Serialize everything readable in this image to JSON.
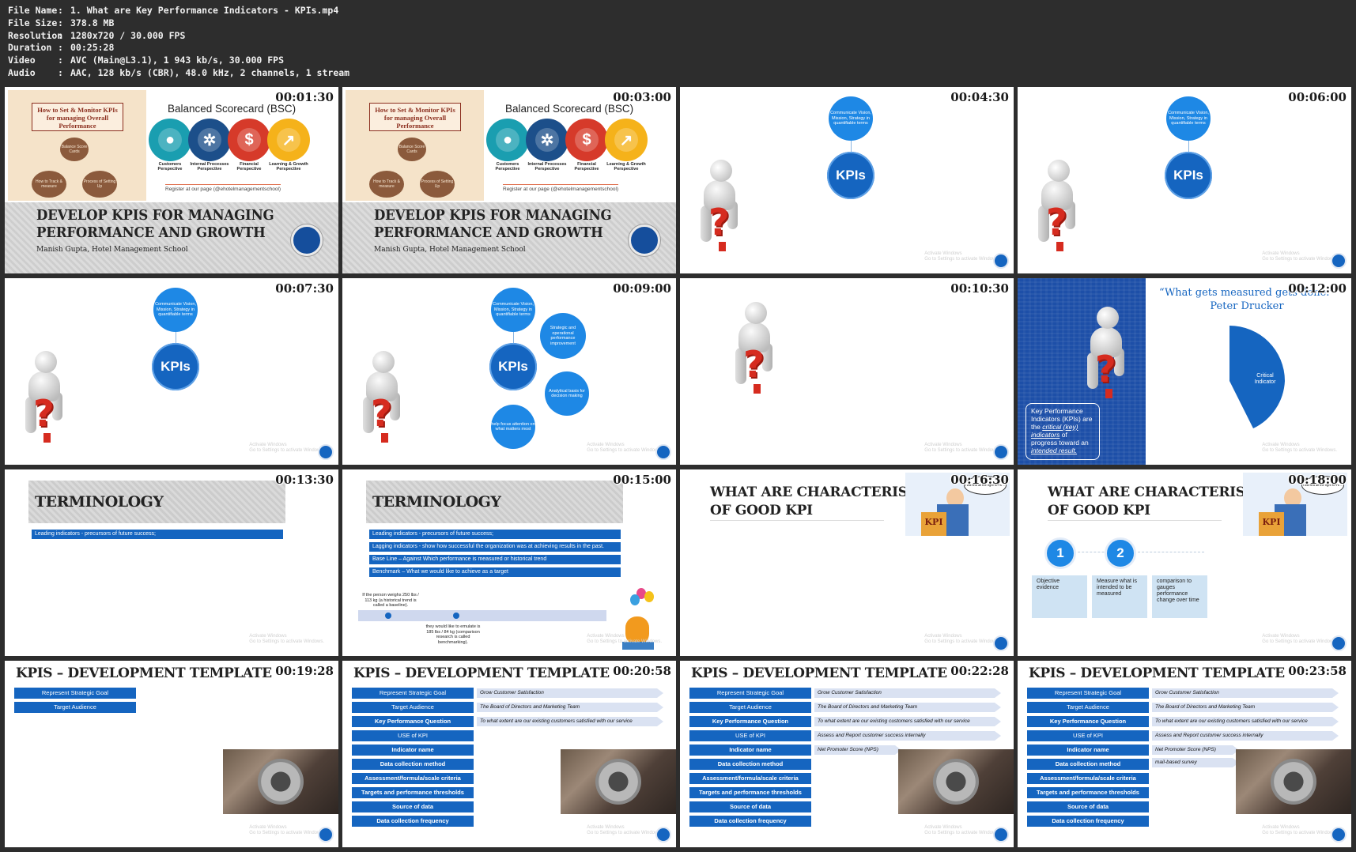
{
  "info": {
    "rows": [
      {
        "key": "File Name",
        "value": "1. What are Key Performance Indicators - KPIs.mp4"
      },
      {
        "key": "File Size",
        "value": "378.8 MB"
      },
      {
        "key": "Resolution",
        "value": "1280x720 / 30.000 FPS"
      },
      {
        "key": "Duration",
        "value": "00:25:28"
      },
      {
        "key": "Video",
        "value": "AVC (Main@L3.1), 1 943 kb/s, 30.000 FPS"
      },
      {
        "key": "Audio",
        "value": "AAC, 128 kb/s (CBR), 48.0 kHz, 2 channels, 1 stream"
      }
    ]
  },
  "timestamps": [
    "00:01:30",
    "00:03:00",
    "00:04:30",
    "00:06:00",
    "00:07:30",
    "00:09:00",
    "00:10:30",
    "00:12:00",
    "00:13:30",
    "00:15:00",
    "00:16:30",
    "00:18:00",
    "00:19:28",
    "00:20:58",
    "00:22:28",
    "00:23:58"
  ],
  "watermark": {
    "line1": "Activate Windows",
    "line2": "Go to Settings to activate Windows."
  },
  "slide_title": {
    "box": "How to Set & Monitor KPIs for managing Overall Performance",
    "bsc_title": "Balanced Scorecard (BSC)",
    "circ_top": "Balance Score Cards",
    "circ_left": "How to Track & measure",
    "circ_right": "Process of Setting Up",
    "perspectives": [
      "Customers Perspective",
      "Internal Processes Perspective",
      "Financial Perspective",
      "Learning & Growth Perspective"
    ],
    "register": "Register at our page (@ehotelmanagementschool)",
    "heading_line1": "DEVELOP KPIS FOR MANAGING",
    "heading_line2": "PERFORMANCE AND GROWTH",
    "author": "Manish Gupta, Hotel Management School"
  },
  "kpi_diagram": {
    "center": "KPIs",
    "top": "Communicate Vision, Mission, Strategy in quantifiable terms",
    "right_top": "Strategic and operational performance improvement",
    "right_bottom": "Analytical basis for decision making",
    "bottom": "help focus attention on what matters most"
  },
  "drucker": {
    "quote": "“What gets measured gets done.”",
    "author": "Peter Drucker",
    "wedge": "Critical Indicator",
    "box_pre": "Key Performance Indicators (KPIs) are the ",
    "box_em1": "critical (key) indicators",
    "box_mid": " of progress toward an ",
    "box_em2": "intended result."
  },
  "terminology": {
    "title": "TERMINOLOGY",
    "bars": [
      "Leading indicators - precursors of future success;",
      "Lagging indicators - show how successful the organization was at achieving results in the past.",
      "Base Line – Against Which performance is measured or historical trend",
      "Benchmark – What we would like to achieve as a target"
    ],
    "timeline_left": "If the person weighs 250 lbs / 113 kg (a historical trend is called a baseline).",
    "timeline_right": "they would like to emulate is 185 lbs / 84 kg (comparison research is called benchmarking)."
  },
  "characteristics": {
    "line1": "WHAT ARE CHARACTERISTICS",
    "line2": "OF GOOD KPI",
    "cartoon_bubble": "I will find all the right KPI's ...",
    "sign": "KPI",
    "steps": [
      {
        "num": "1",
        "text": "Objective evidence"
      },
      {
        "num": "2",
        "text": "Measure what is intended to be measured"
      },
      {
        "num": "",
        "text": "comparison to gauges performance change over time"
      }
    ]
  },
  "template": {
    "title": "KPIS – DEVELOPMENT TEMPLATE",
    "buttons": [
      "Represent Strategic Goal",
      "Target Audience",
      "Key Performance Question",
      "USE of KPI",
      "Indicator name",
      "Data collection method",
      "Assessment/formula/scale criteria",
      "Targets and performance thresholds",
      "Source of data",
      "Data collection frequency"
    ],
    "answers": [
      "Grow Customer Satisfaction",
      "The Board of Directors and Marketing Team",
      "To what extent are our existing customers satisfied with our service",
      "Assess and Report customer success internally",
      "Net Promoter Score (NPS)",
      "mail-based survey"
    ]
  },
  "colors": {
    "background": "#2d2d2d",
    "accent_blue": "#1565c0",
    "light_blue": "#1e88e5",
    "question_red": "#d62b1f"
  }
}
